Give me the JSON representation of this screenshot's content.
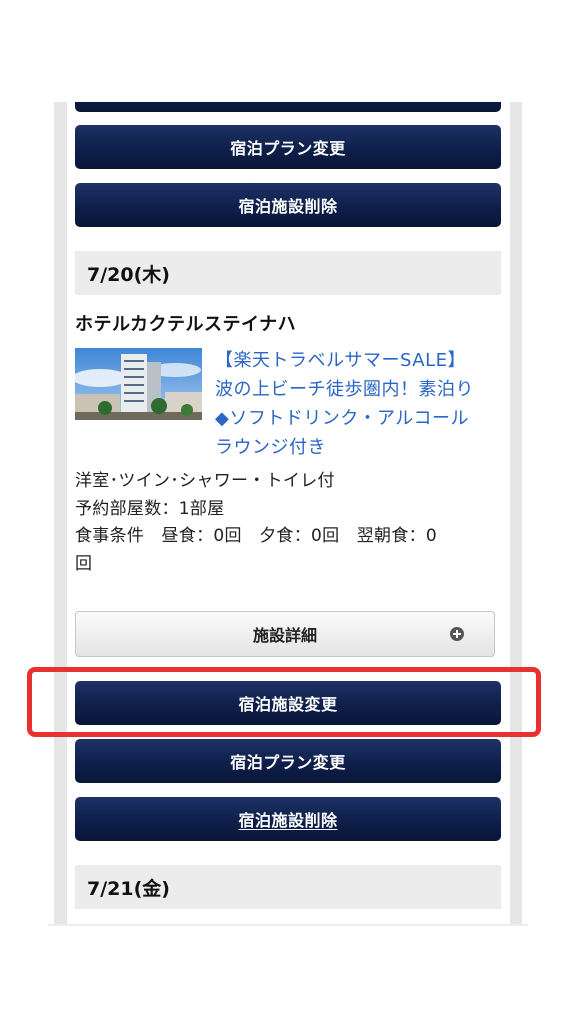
{
  "buttons": {
    "change_facility": "宿泊施設変更",
    "change_plan": "宿泊プラン変更",
    "delete_facility": "宿泊施設削除",
    "facility_details": "施設詳細"
  },
  "days": [
    {
      "date": "7/20(木)",
      "hotel_name": "ホテルカクテルステイナハ",
      "plan_title_lines": [
        "【楽天トラベルサマーSALE】",
        "波の上ビーチ徒歩圏内！素泊り",
        "◆ソフトドリンク・アルコール",
        "ラウンジ付き"
      ],
      "room_type": "洋室･ツイン･シャワー・トイレ付",
      "rooms_line": "予約部屋数：1部屋",
      "meals_line1": "食事条件　昼食：0回　夕食：0回　翌朝食：0",
      "meals_line2": "回"
    },
    {
      "date": "7/21(金)"
    }
  ],
  "colors": {
    "navy": "#0e1f4a",
    "link_blue": "#2a66c4",
    "highlight_red": "#ea3131"
  }
}
